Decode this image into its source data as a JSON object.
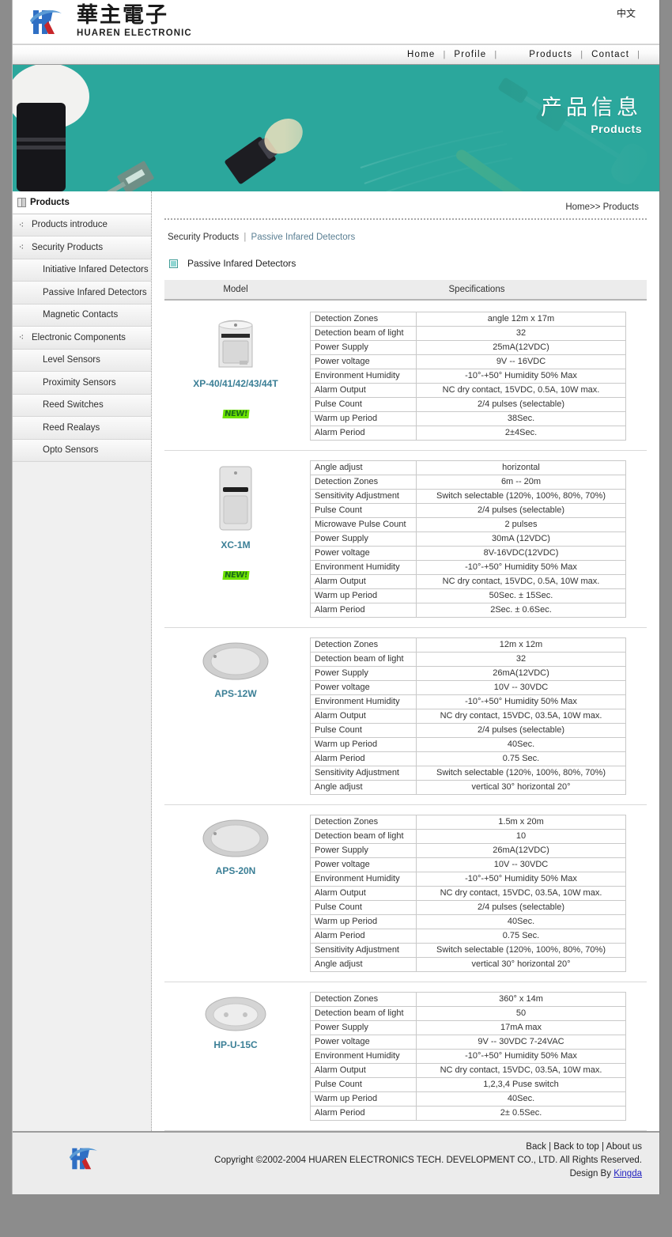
{
  "header": {
    "brand_cn": "華主電子",
    "brand_en": "HUAREN ELECTRONIC",
    "lang_link": "中文",
    "logo_icon": "hk-logo-icon"
  },
  "nav": {
    "items": [
      {
        "label": "Home",
        "sep": "|"
      },
      {
        "label": "Profile",
        "sep": "|"
      },
      {
        "label": "Products",
        "sep": "|"
      },
      {
        "label": "Contact",
        "sep": "|"
      }
    ]
  },
  "banner": {
    "title_cn": "产品信息",
    "title_en": "Products",
    "bg_color": "#2ba79c"
  },
  "sidebar": {
    "items": [
      {
        "label": "Products",
        "level": 1,
        "icon": "book-icon"
      },
      {
        "label": "Products introduce",
        "level": 2,
        "icon": "bullet-icon"
      },
      {
        "label": "Security Products",
        "level": 2,
        "icon": "bullet-icon"
      },
      {
        "label": "Initiative Infared Detectors",
        "level": 3,
        "icon": ""
      },
      {
        "label": "Passive Infared Detectors",
        "level": 3,
        "icon": ""
      },
      {
        "label": "Magnetic Contacts",
        "level": 3,
        "icon": ""
      },
      {
        "label": "Electronic Components",
        "level": 2,
        "icon": "bullet-icon"
      },
      {
        "label": "Level Sensors",
        "level": 3,
        "icon": ""
      },
      {
        "label": "Proximity Sensors",
        "level": 3,
        "icon": ""
      },
      {
        "label": "Reed Switches",
        "level": 3,
        "icon": ""
      },
      {
        "label": "Reed Realays",
        "level": 3,
        "icon": ""
      },
      {
        "label": "Opto Sensors",
        "level": 3,
        "icon": ""
      }
    ]
  },
  "content": {
    "breadcrumb_top": "Home>> Products",
    "subcrumb_root": "Security Products",
    "subcrumb_sep": "|",
    "subcrumb_current": "Passive Infared Detectors",
    "section_title": "Passive Infared Detectors",
    "table_header": {
      "model": "Model",
      "specifications": "Specifications"
    },
    "new_badge": "NEW!",
    "products": [
      {
        "model": "XP-40/41/42/43/44T",
        "image": "pir-wall-mount-icon",
        "is_new": true,
        "specs": [
          {
            "k": "Detection Zones",
            "v": "angle 12m x 17m"
          },
          {
            "k": "Detection beam of light",
            "v": "32"
          },
          {
            "k": "Power Supply",
            "v": "25mA(12VDC)"
          },
          {
            "k": "Power voltage",
            "v": "9V -- 16VDC"
          },
          {
            "k": "Environment Humidity",
            "v": "-10°-+50° Humidity 50% Max"
          },
          {
            "k": "Alarm Output",
            "v": "NC dry contact, 15VDC, 0.5A, 10W max."
          },
          {
            "k": "Pulse Count",
            "v": "2/4 pulses (selectable)"
          },
          {
            "k": "Warm up Period",
            "v": "38Sec."
          },
          {
            "k": "Alarm Period",
            "v": "2±4Sec."
          }
        ]
      },
      {
        "model": "XC-1M",
        "image": "pir-rect-icon",
        "is_new": true,
        "specs": [
          {
            "k": "Angle adjust",
            "v": "horizontal"
          },
          {
            "k": "Detection Zones",
            "v": "6m -- 20m"
          },
          {
            "k": "Sensitivity Adjustment",
            "v": "Switch selectable (120%, 100%, 80%, 70%)"
          },
          {
            "k": "Pulse Count",
            "v": "2/4 pulses (selectable)"
          },
          {
            "k": "Microwave Pulse Count",
            "v": "2 pulses"
          },
          {
            "k": "Power Supply",
            "v": "30mA (12VDC)"
          },
          {
            "k": "Power voltage",
            "v": "8V-16VDC(12VDC)"
          },
          {
            "k": "Environment Humidity",
            "v": "-10°-+50° Humidity 50% Max"
          },
          {
            "k": "Alarm Output",
            "v": "NC dry contact, 15VDC, 0.5A, 10W max."
          },
          {
            "k": "Warm up Period",
            "v": "50Sec. ± 15Sec."
          },
          {
            "k": "Alarm Period",
            "v": "2Sec. ± 0.6Sec."
          }
        ]
      },
      {
        "model": "APS-12W",
        "image": "pir-ceiling-oval-icon",
        "is_new": false,
        "specs": [
          {
            "k": "Detection Zones",
            "v": "12m x 12m"
          },
          {
            "k": "Detection beam of light",
            "v": "32"
          },
          {
            "k": "Power Supply",
            "v": "26mA(12VDC)"
          },
          {
            "k": "Power voltage",
            "v": "10V -- 30VDC"
          },
          {
            "k": "Environment Humidity",
            "v": "-10°-+50° Humidity 50% Max"
          },
          {
            "k": "Alarm Output",
            "v": "NC dry contact, 15VDC, 03.5A, 10W max."
          },
          {
            "k": "Pulse Count",
            "v": "2/4 pulses (selectable)"
          },
          {
            "k": "Warm up Period",
            "v": "40Sec."
          },
          {
            "k": "Alarm Period",
            "v": "0.75 Sec."
          },
          {
            "k": "Sensitivity Adjustment",
            "v": "Switch selectable (120%, 100%, 80%, 70%)"
          },
          {
            "k": "Angle adjust",
            "v": "vertical 30° horizontal 20°"
          }
        ]
      },
      {
        "model": "APS-20N",
        "image": "pir-ceiling-oval-icon",
        "is_new": false,
        "specs": [
          {
            "k": "Detection Zones",
            "v": "1.5m x 20m"
          },
          {
            "k": "Detection beam of light",
            "v": "10"
          },
          {
            "k": "Power Supply",
            "v": "26mA(12VDC)"
          },
          {
            "k": "Power voltage",
            "v": "10V -- 30VDC"
          },
          {
            "k": "Environment Humidity",
            "v": "-10°-+50° Humidity 50% Max"
          },
          {
            "k": "Alarm Output",
            "v": "NC dry contact, 15VDC, 03.5A, 10W max."
          },
          {
            "k": "Pulse Count",
            "v": "2/4 pulses (selectable)"
          },
          {
            "k": "Warm up Period",
            "v": "40Sec."
          },
          {
            "k": "Alarm Period",
            "v": "0.75 Sec."
          },
          {
            "k": "Sensitivity Adjustment",
            "v": "Switch selectable (120%, 100%, 80%, 70%)"
          },
          {
            "k": "Angle adjust",
            "v": "vertical 30° horizontal 20°"
          }
        ]
      },
      {
        "model": "HP-U-15C",
        "image": "pir-ceiling-round-icon",
        "is_new": false,
        "specs": [
          {
            "k": "Detection Zones",
            "v": "360° x 14m"
          },
          {
            "k": "Detection beam of light",
            "v": "50"
          },
          {
            "k": "Power Supply",
            "v": "17mA max"
          },
          {
            "k": "Power voltage",
            "v": "9V -- 30VDC 7-24VAC"
          },
          {
            "k": "Environment Humidity",
            "v": "-10°-+50° Humidity 50% Max"
          },
          {
            "k": "Alarm Output",
            "v": "NC dry contact, 15VDC, 03.5A, 10W max."
          },
          {
            "k": "Pulse Count",
            "v": "1,2,3,4 Puse switch"
          },
          {
            "k": "Warm up Period",
            "v": "40Sec."
          },
          {
            "k": "Alarm Period",
            "v": "2± 0.5Sec."
          }
        ]
      }
    ]
  },
  "footer": {
    "links": [
      {
        "label": "Back"
      },
      {
        "label": "Back to top"
      },
      {
        "label": "About us"
      }
    ],
    "link_sep": "|",
    "copyright": "Copyright ©2002-2004 HUAREN ELECTRONICS TECH. DEVELOPMENT CO., LTD. All Rights Reserved.",
    "design_prefix": "Design By",
    "design_by": "Kingda",
    "logo_icon": "hk-logo-icon"
  }
}
